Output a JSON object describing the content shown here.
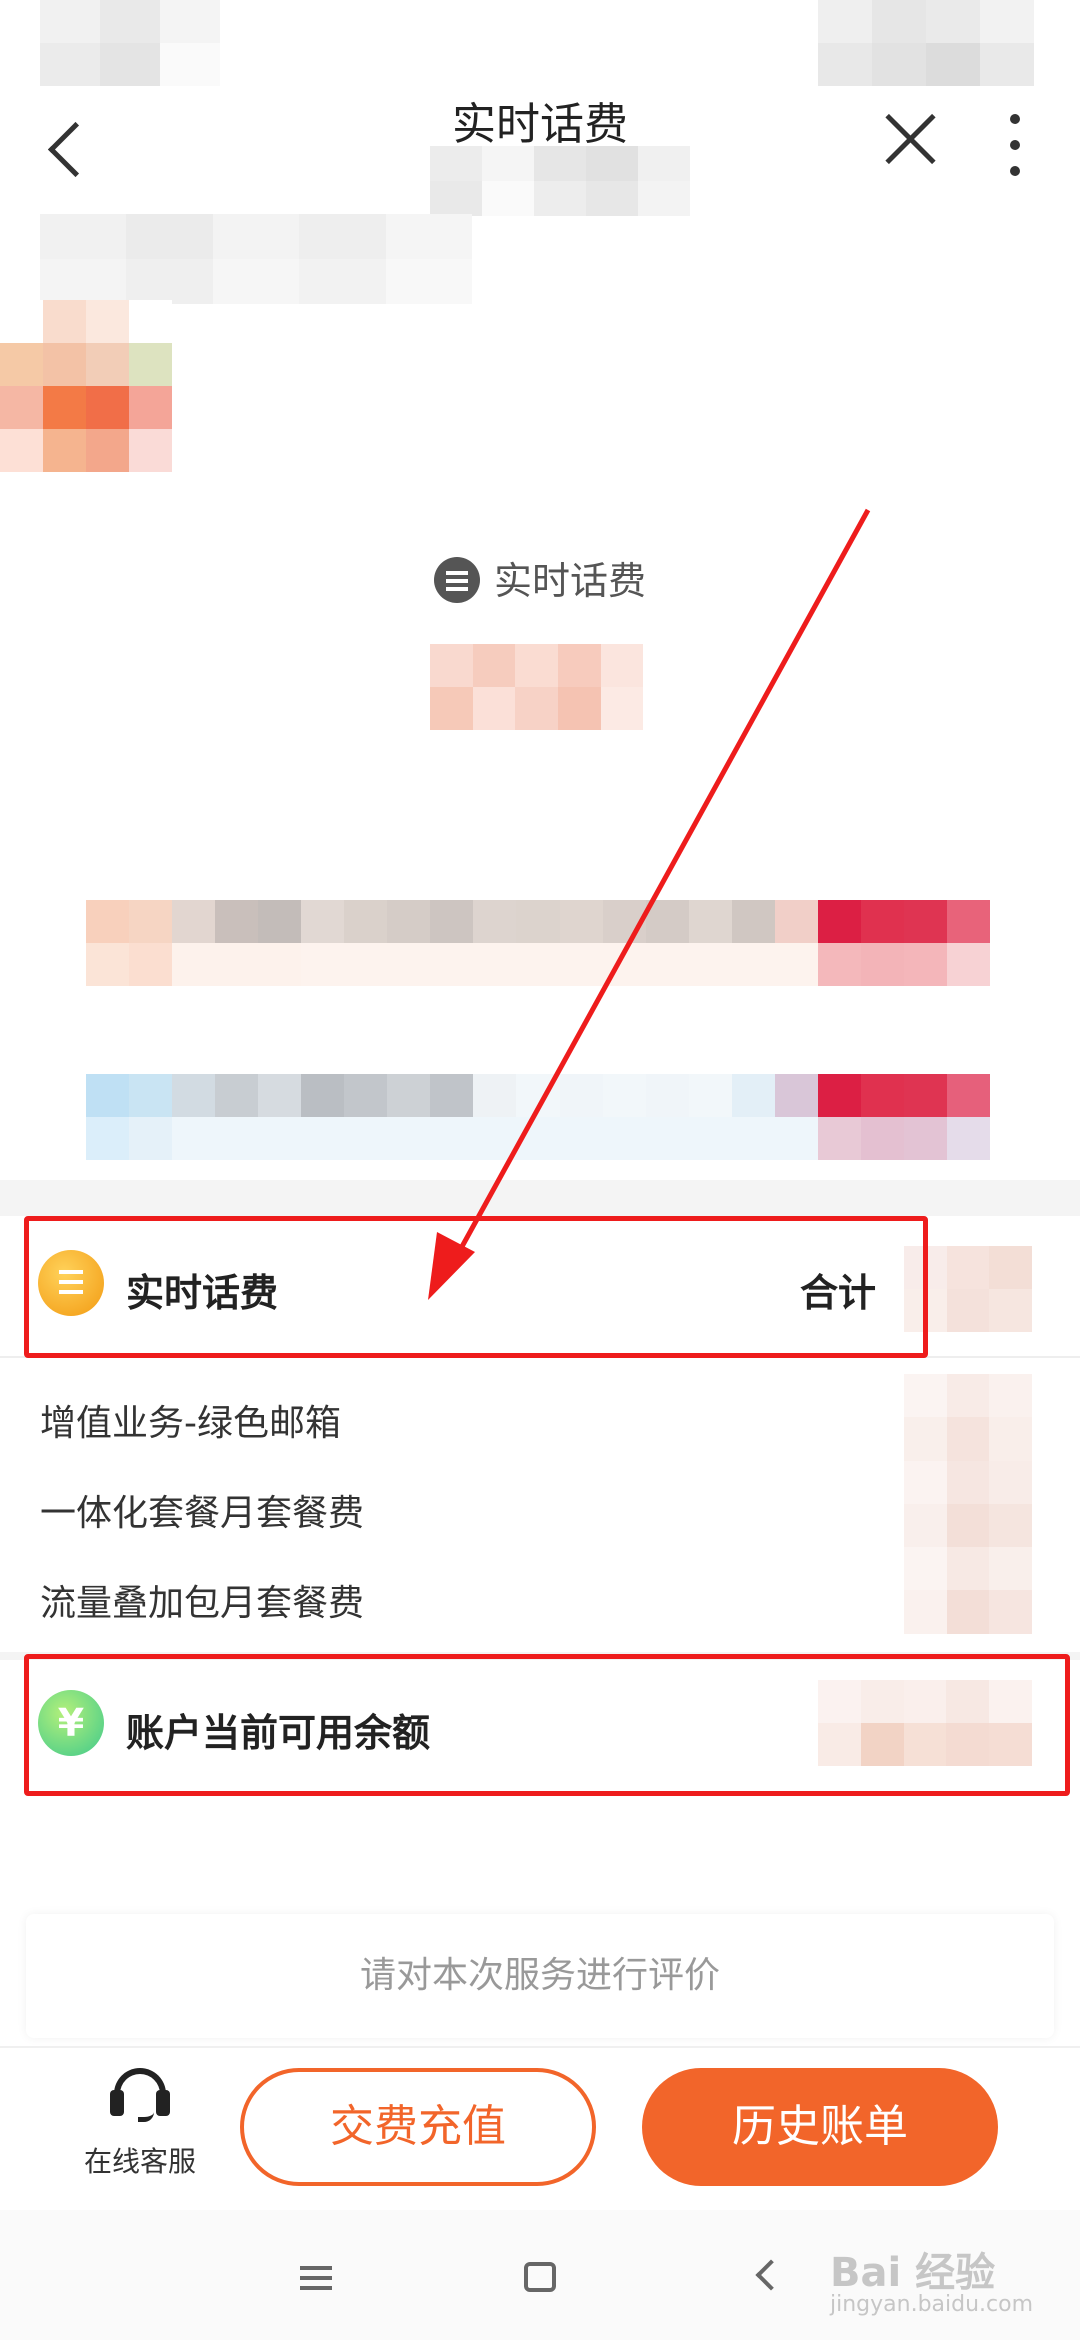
{
  "header": {
    "title": "实时话费"
  },
  "summary": {
    "label": "实时话费"
  },
  "fee_section": {
    "title": "实时话费",
    "total_label": "合计",
    "items": [
      {
        "name": "增值业务-绿色邮箱"
      },
      {
        "name": "一体化套餐月套餐费"
      },
      {
        "name": "流量叠加包月套餐费"
      }
    ]
  },
  "balance_section": {
    "title": "账户当前可用余额",
    "currency_symbol": "¥"
  },
  "rating": {
    "prompt": "请对本次服务进行评价"
  },
  "bottom_bar": {
    "service_label": "在线客服",
    "pay_label": "交费充值",
    "history_label": "历史账单"
  },
  "watermark": {
    "brand": "Bai 经验",
    "url": "jingyan.baidu.com"
  },
  "colors": {
    "accent_orange": "#f2652a",
    "annotation_red": "#ee1c1c",
    "fee_icon_orange": "#f5a21b",
    "balance_icon_green": "#7ed36a"
  },
  "icons": {
    "back": "chevron-left-icon",
    "close": "close-icon",
    "more": "more-vertical-icon",
    "summary": "list-icon",
    "fee": "list-icon",
    "balance": "yen-icon",
    "service": "headset-icon"
  }
}
